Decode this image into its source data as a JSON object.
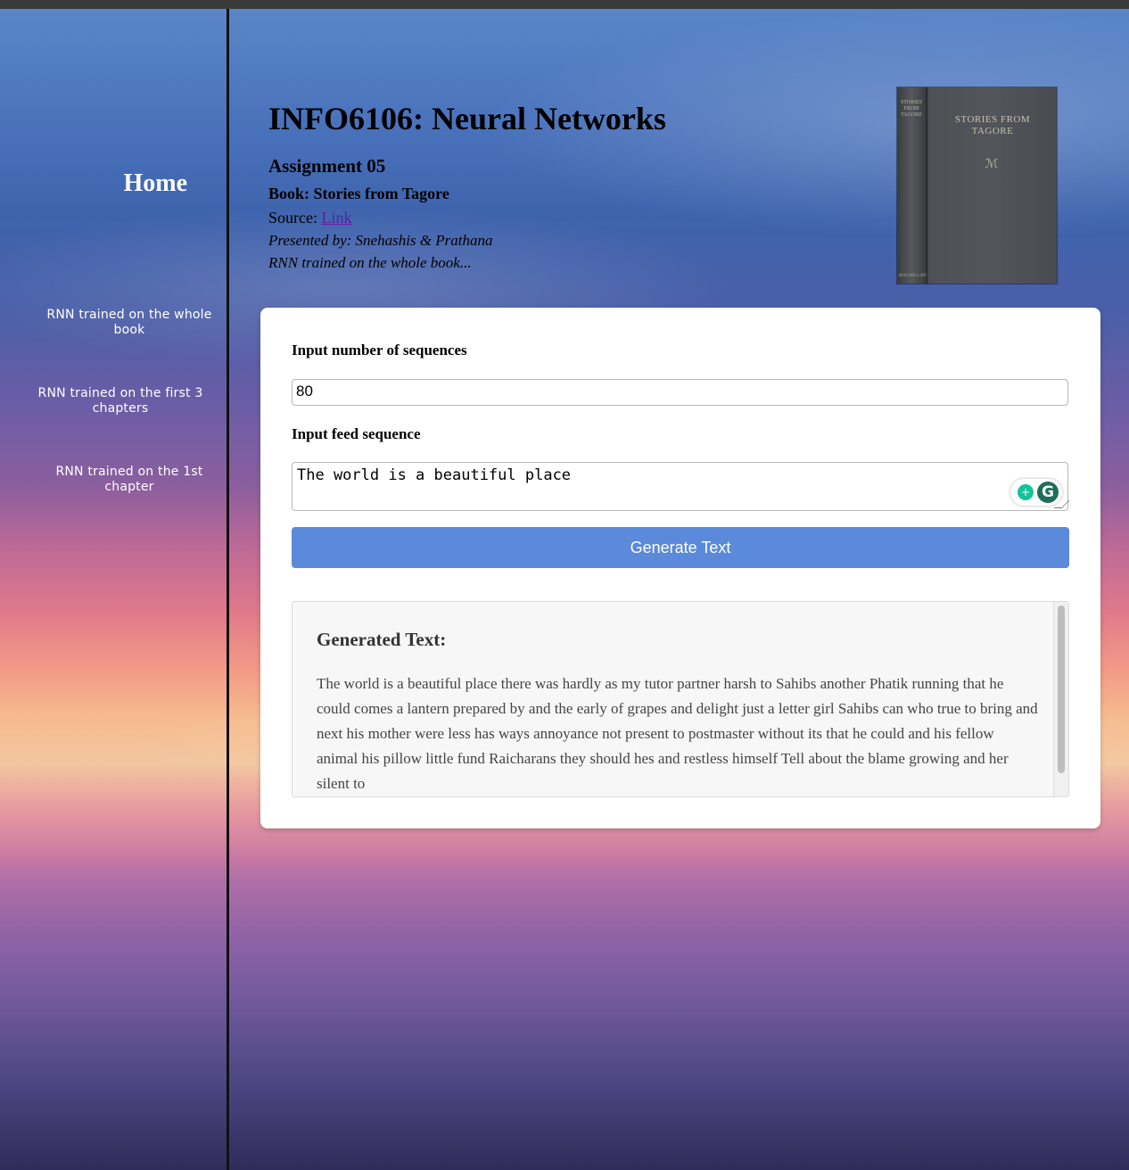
{
  "sidebar": {
    "home": "Home",
    "items": [
      {
        "label": "RNN trained on the whole book"
      },
      {
        "label": "RNN trained on the first 3 chapters"
      },
      {
        "label": "RNN trained on the 1st chapter"
      }
    ]
  },
  "header": {
    "title": "INFO6106: Neural Networks",
    "assignment": "Assignment 05",
    "book": "Book: Stories from Tagore",
    "source_prefix": "Source: ",
    "source_link": "Link",
    "presented": "Presented by: Snehashis & Prathana",
    "model": "RNN trained on the whole book..."
  },
  "book_cover": {
    "title": "STORIES FROM TAGORE",
    "spine_title": "STORIES FROM TAGORE",
    "spine_publisher": "MACMILLAN",
    "monogram": "ℳ",
    "color": "#4a4d52"
  },
  "form": {
    "num_label": "Input number of sequences",
    "num_value": "80",
    "feed_label": "Input feed sequence",
    "feed_value": "The world is a beautiful place",
    "button": "Generate Text",
    "button_color": "#5a8ad9"
  },
  "output": {
    "heading": "Generated Text:",
    "text": "The world is a beautiful place there was hardly as my tutor partner harsh to Sahibs another Phatik running that he could comes a lantern prepared by and the early of grapes and delight just a letter girl Sahibs can who true to bring and next his mother were less has ways annoyance not present to postmaster without its that he could and his fellow animal his pillow little fund Raicharans they should hes and restless himself Tell about the blame growing and her silent to"
  },
  "icons": {
    "bulb": "lightbulb-icon",
    "grammarly": "grammarly-icon",
    "bulb_glyph": "+",
    "grammarly_glyph": "G"
  }
}
